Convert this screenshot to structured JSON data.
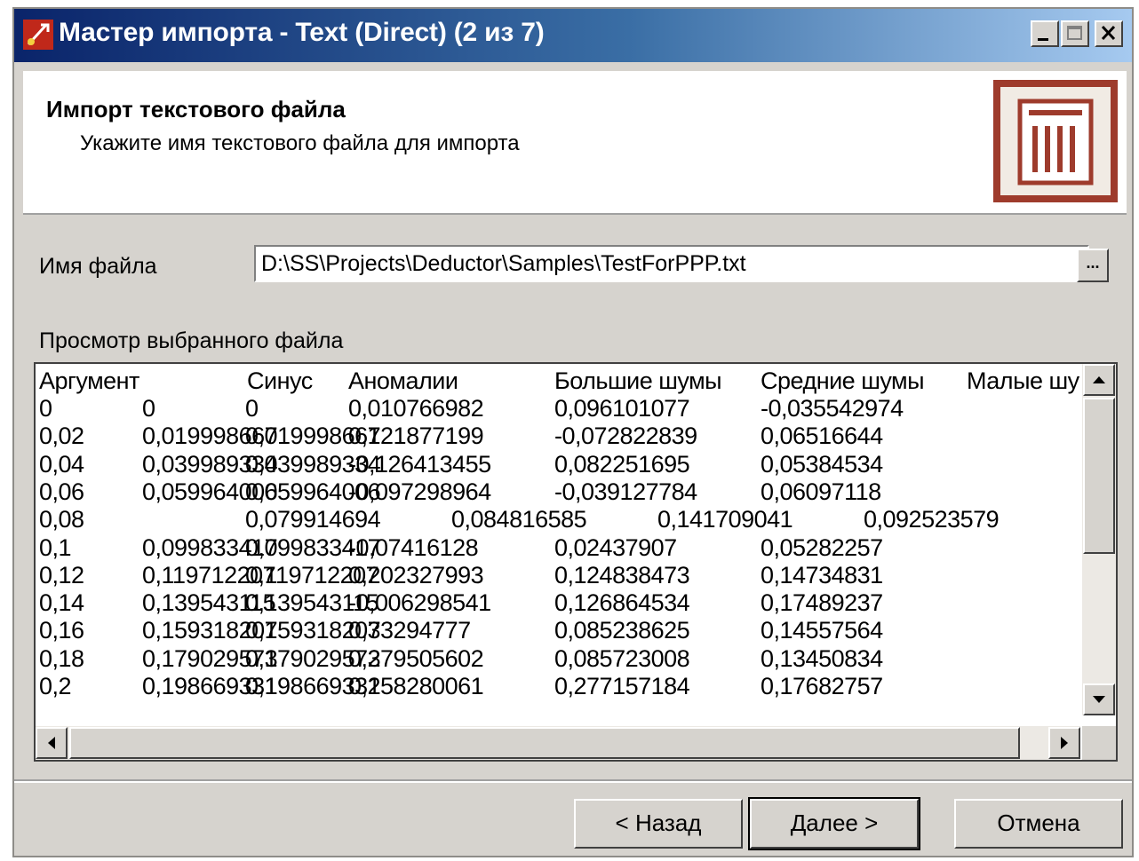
{
  "window": {
    "title": "Мастер импорта - Text (Direct) (2 из 7)"
  },
  "header": {
    "title": "Импорт текстового файла",
    "subtitle": "Укажите имя текстового файла для импорта"
  },
  "file": {
    "label": "Имя файла",
    "value": "D:\\SS\\Projects\\Deductor\\Samples\\TestForPPP.txt",
    "browse_label": "..."
  },
  "preview": {
    "label": "Просмотр выбранного файла",
    "header_row": [
      "Аргумент",
      "Синус",
      "Аномалии",
      "Большие шумы",
      "Средние шумы",
      "Малые шу"
    ],
    "rows": [
      [
        "0",
        "0",
        "0",
        "0,010766982",
        "0,096101077",
        "-0,035542974",
        ""
      ],
      [
        "0,02",
        "0,019998667",
        "0,019998667",
        "0,121877199",
        "-0,072822839",
        "0,06516644"
      ],
      [
        "0,04",
        "0,039989334",
        "0,039989334",
        "-0,126413455",
        "0,082251695",
        "0,05384534"
      ],
      [
        "0,06",
        "0,059964006",
        "0,059964006",
        "-0,097298964",
        "-0,039127784",
        "0,06097118"
      ],
      [
        "0,08",
        "",
        "0,079914694",
        "0,084816585",
        "0,141709041",
        "0,092523579"
      ],
      [
        "0,1",
        "0,099833417",
        "0,099833417",
        "-0,07416128",
        "0,02437907",
        "0,05282257"
      ],
      [
        "0,12",
        "0,119712207",
        "0,119712207",
        "0,202327993",
        "0,124838473",
        "0,14734831"
      ],
      [
        "0,14",
        "0,139543115",
        "0,139543115",
        "-0,006298541",
        "0,126864534",
        "0,17489237"
      ],
      [
        "0,16",
        "0,159318207",
        "0,159318207",
        "0,33294777",
        "0,085238625",
        "0,14557564"
      ],
      [
        "0,18",
        "0,179029573",
        "0,179029573",
        "0,279505602",
        "0,085723008",
        "0,13450834"
      ],
      [
        "0,2",
        "0,198669331",
        "0,198669331",
        "0,258280061",
        "0,277157184",
        "0,17682757"
      ]
    ]
  },
  "buttons": {
    "back": "< Назад",
    "next": "Далее >",
    "cancel": "Отмена"
  }
}
